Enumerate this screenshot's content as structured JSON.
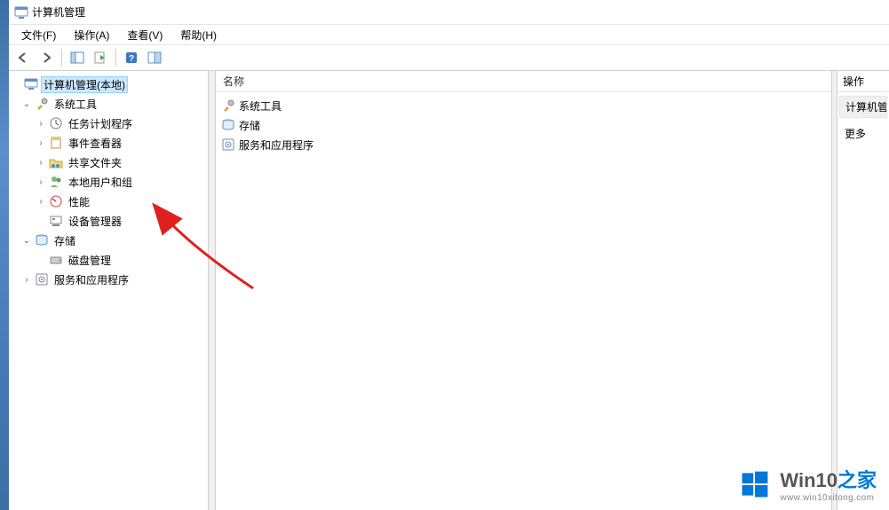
{
  "window": {
    "title": "计算机管理"
  },
  "menu": {
    "file": "文件(F)",
    "action": "操作(A)",
    "view": "查看(V)",
    "help": "帮助(H)"
  },
  "tree": {
    "root": "计算机管理(本地)",
    "system_tools": "系统工具",
    "task_scheduler": "任务计划程序",
    "event_viewer": "事件查看器",
    "shared_folders": "共享文件夹",
    "local_users_groups": "本地用户和组",
    "performance": "性能",
    "device_manager": "设备管理器",
    "storage": "存储",
    "disk_management": "磁盘管理",
    "services_apps": "服务和应用程序"
  },
  "list": {
    "header_name": "名称",
    "items": {
      "system_tools": "系统工具",
      "storage": "存储",
      "services_apps": "服务和应用程序"
    }
  },
  "actions": {
    "header": "操作",
    "heading": "计算机管",
    "more": "更多"
  },
  "watermark": {
    "brand": "Win10",
    "suffix": "之家",
    "url": "www.win10xitong.com"
  }
}
